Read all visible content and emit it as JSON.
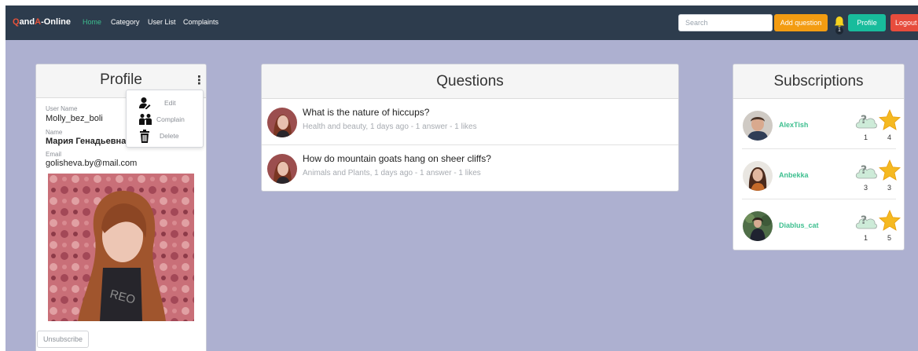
{
  "navbar": {
    "brand_q": "Q",
    "brand_and": "and",
    "brand_a": "A",
    "brand_rest": "-Online",
    "links": {
      "home": "Home",
      "category": "Category",
      "user_list": "User List",
      "complaints": "Complaints"
    },
    "search_placeholder": "Search",
    "add_question": "Add question",
    "notification_count": "1",
    "profile": "Profile",
    "logout": "Logout"
  },
  "profile_card": {
    "title": "Profile",
    "menu_icon": "⋮",
    "username_label": "User Name",
    "username": "Molly_bez_boli",
    "name_label": "Name",
    "name": "Мария Генадьевна",
    "email_label": "Email",
    "email": "golisheva.by@mail.com",
    "unsubscribe": "Unsubscribe",
    "dropdown": {
      "edit": "Edit",
      "complain": "Complain",
      "delete": "Delete"
    }
  },
  "questions_card": {
    "title": "Questions",
    "items": [
      {
        "title": "What is the nature of hiccups?",
        "meta": "Health and beauty, 1 days ago - 1 answer - 1 likes"
      },
      {
        "title": "How do mountain goats hang on sheer cliffs?",
        "meta": "Animals and Plants, 1 days ago - 1 answer - 1 likes"
      }
    ]
  },
  "subscriptions_card": {
    "title": "Subscriptions",
    "items": [
      {
        "name": "AlexTish",
        "questions": "1",
        "likes": "4"
      },
      {
        "name": "Anbekka",
        "questions": "3",
        "likes": "3"
      },
      {
        "name": "Diablus_cat",
        "questions": "1",
        "likes": "5"
      }
    ]
  },
  "colors": {
    "navbar_bg": "#2d3c4d",
    "page_bg": "#adb0d0",
    "brand_accent": "#e8533b",
    "active_link": "#3dbf8f",
    "add_button": "#f39c12",
    "profile_button": "#18bc9c",
    "logout_button": "#e74c3c",
    "subscription_name": "#3dbf8f",
    "star": "#f5b921"
  },
  "icons": {
    "bell": "bell-icon",
    "menu": "kebab-menu-icon",
    "edit": "user-edit-icon",
    "complain": "complain-icon",
    "delete": "trash-icon",
    "questions": "cloud-question-icon",
    "likes": "star-icon"
  }
}
